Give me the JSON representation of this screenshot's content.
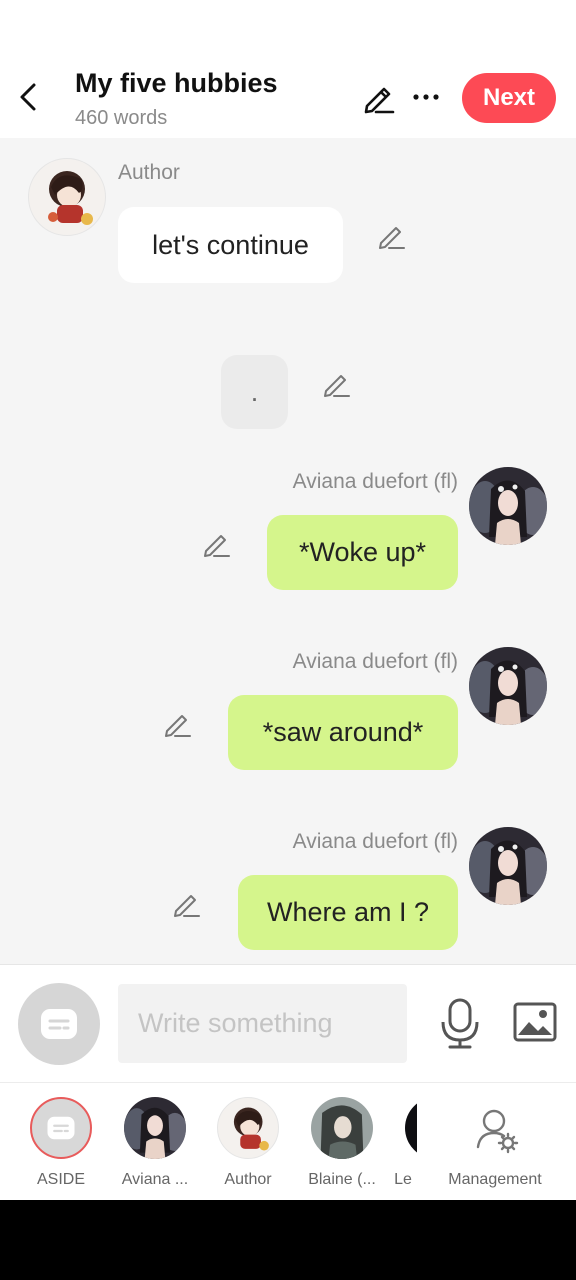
{
  "header": {
    "title": "My five hubbies",
    "word_count": "460 words",
    "next_label": "Next"
  },
  "messages": [
    {
      "speaker": "Author",
      "text": "let's continue",
      "side": "left",
      "style": "white"
    },
    {
      "speaker": "",
      "text": ".",
      "side": "center",
      "style": "grey"
    },
    {
      "speaker": "Aviana duefort (fl)",
      "text": "*Woke up*",
      "side": "right",
      "style": "green"
    },
    {
      "speaker": "Aviana duefort (fl)",
      "text": "*saw around*",
      "side": "right",
      "style": "green"
    },
    {
      "speaker": "Aviana duefort (fl)",
      "text": "Where am I ?",
      "side": "right",
      "style": "green"
    }
  ],
  "input": {
    "placeholder": "Write something"
  },
  "characters": [
    {
      "label": "ASIDE",
      "icon": "aside-icon"
    },
    {
      "label": "Aviana ...",
      "icon": "avatar"
    },
    {
      "label": "Author",
      "icon": "avatar"
    },
    {
      "label": "Blaine (...",
      "icon": "avatar"
    },
    {
      "label": "Le",
      "icon": "avatar"
    },
    {
      "label": "Management",
      "icon": "management-icon"
    }
  ],
  "colors": {
    "accent": "#fd4a55",
    "bubble_user": "#d5f58c",
    "bubble_author": "#ffffff"
  }
}
